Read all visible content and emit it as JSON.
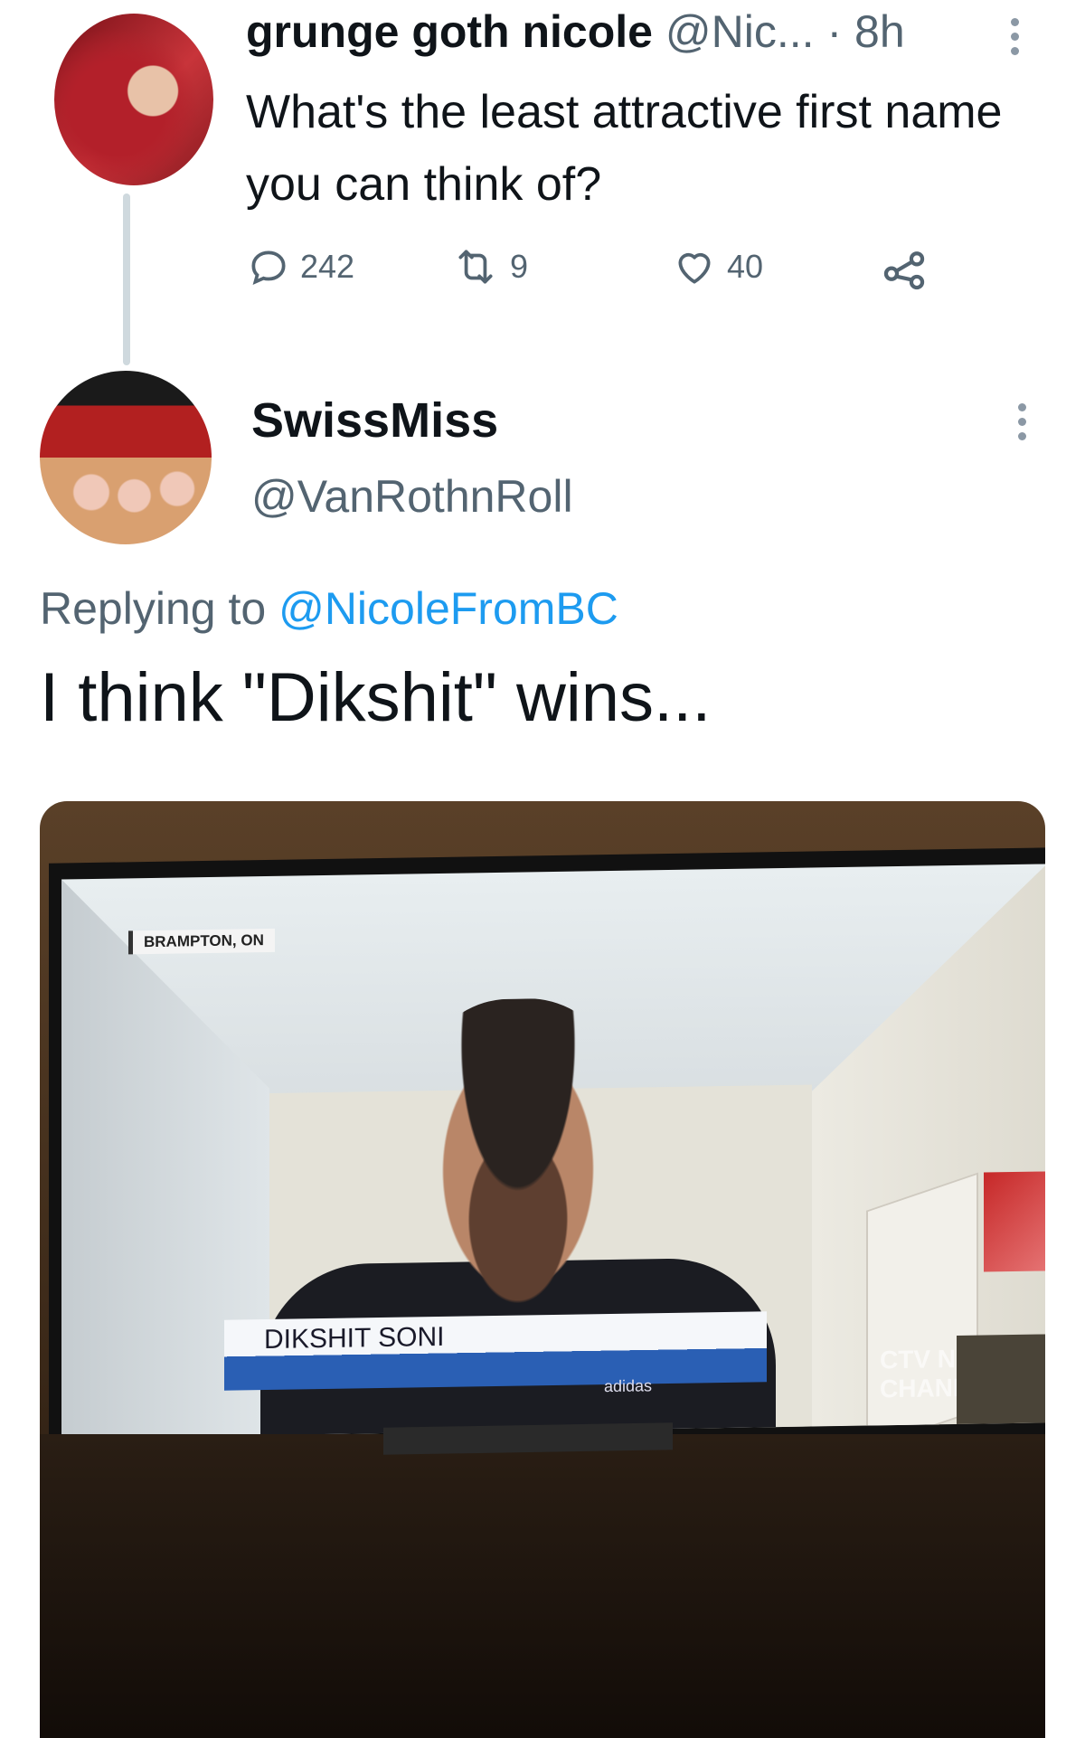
{
  "parent_tweet": {
    "display_name": "grunge goth nicole",
    "handle": "@Nic...",
    "separator": "·",
    "time": "8h",
    "text": "What's the least attractive first name you can think of?",
    "reply_count": "242",
    "retweet_count": "9",
    "like_count": "40",
    "icons": {
      "reply": "comment-icon",
      "retweet": "retweet-icon",
      "like": "heart-icon",
      "share": "share-icon",
      "more": "more-vertical-icon"
    }
  },
  "reply_tweet": {
    "display_name": "SwissMiss",
    "handle": "@VanRothnRoll",
    "replying_prefix": "Replying to",
    "replying_to": "@NicoleFromBC",
    "text": "I think \"Dikshit\" wins...",
    "icons": {
      "more": "more-vertical-icon"
    }
  },
  "media": {
    "location_tag": "BRAMPTON, ON",
    "lower_third_name": "DIKSHIT SONI",
    "channel_logo": "CTV NEWS CHANNEL",
    "shirt_brand": "adidas"
  },
  "colors": {
    "link": "#1d9bf0",
    "secondary_text": "#536471",
    "thread_line": "#cfd9de"
  }
}
